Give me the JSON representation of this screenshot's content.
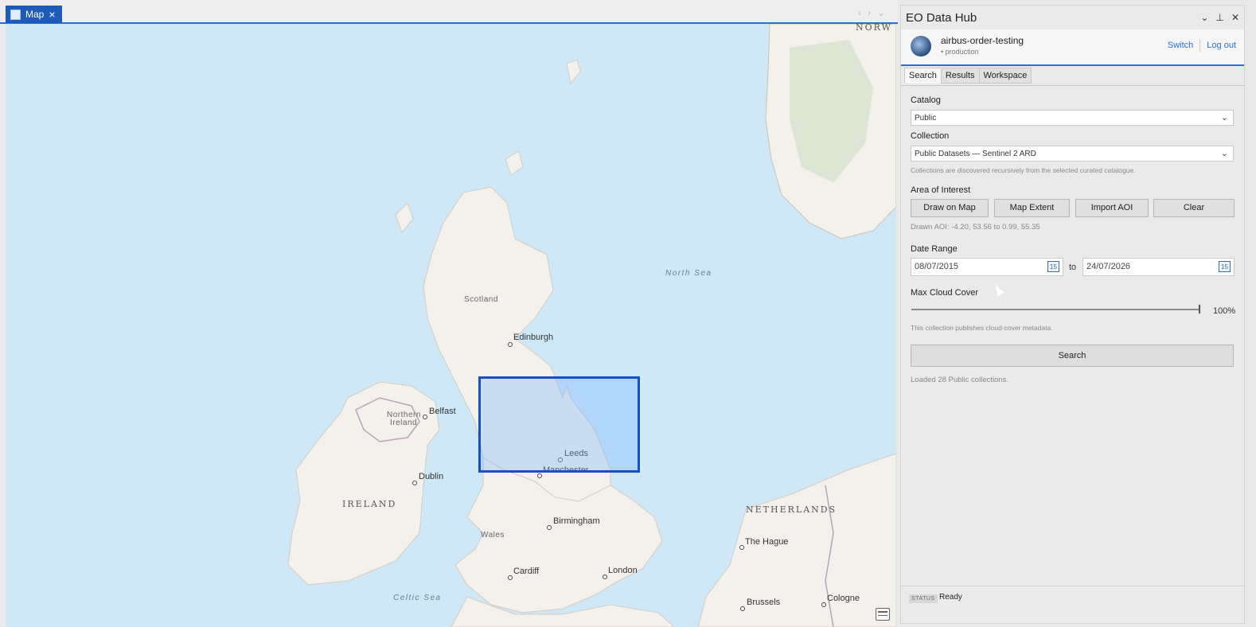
{
  "map_tab": {
    "label": "Map"
  },
  "map": {
    "labels": {
      "edinburgh": "Edinburgh",
      "belfast": "Belfast",
      "dublin": "Dublin",
      "leeds": "Leeds",
      "manchester": "Manchester",
      "birmingham": "Birmingham",
      "cardiff": "Cardiff",
      "london": "London",
      "the_hague": "The Hague",
      "brussels": "Brussels",
      "cologne": "Cologne",
      "scotland": "Scotland",
      "northern_ireland_1": "Northern",
      "northern_ireland_2": "Ireland",
      "wales": "Wales",
      "ireland": "IRELAND",
      "netherlands": "NETHERLANDS",
      "north_sea": "North Sea",
      "celtic_sea": "Celtic Sea",
      "norway_edge": "NORW"
    }
  },
  "panel": {
    "title": "EO Data Hub",
    "account": {
      "name": "airbus-order-testing",
      "environment": "production",
      "switch_label": "Switch",
      "logout_label": "Log out"
    },
    "tabs": [
      "Search",
      "Results",
      "Workspace"
    ],
    "catalog": {
      "label": "Catalog",
      "value": "Public"
    },
    "collection": {
      "label": "Collection",
      "value": "Public Datasets — Sentinel 2 ARD",
      "hint": "Collections are discovered recursively from the selected curated catalogue."
    },
    "aoi": {
      "label": "Area of Interest",
      "buttons": [
        "Draw on Map",
        "Map Extent",
        "Import AOI",
        "Clear"
      ],
      "drawn": "Drawn AOI: -4.20, 53.56 to 0.99, 55.35"
    },
    "date_range": {
      "label": "Date Range",
      "from": "08/07/2015",
      "to_label": "to",
      "to": "24/07/2026",
      "cal_day": "15"
    },
    "cloud": {
      "label": "Max Cloud Cover",
      "value_text": "100%",
      "value": 100,
      "hint": "This collection publishes cloud-cover metadata."
    },
    "search_label": "Search",
    "loaded_text": "Loaded 28 Public collections.",
    "status": {
      "key": "STATUS",
      "value": "Ready"
    }
  },
  "colors": {
    "accent": "#2a6fd1",
    "aoi": "#1450c8",
    "sea": "#cfe8f8",
    "land": "#f4f1ec"
  }
}
